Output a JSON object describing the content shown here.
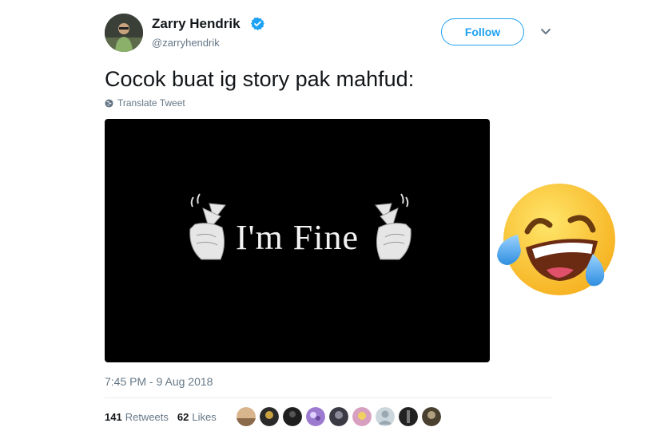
{
  "tweet": {
    "author": {
      "display_name": "Zarry Hendrik",
      "handle": "@zarryhendrik",
      "verified": true
    },
    "follow_label": "Follow",
    "text": "Cocok buat ig story pak mahfud:",
    "translate_label": "Translate Tweet",
    "media": {
      "caption": "I'm Fine"
    },
    "timestamp": "7:45 PM - 9 Aug 2018",
    "stats": {
      "retweets_count": "141",
      "retweets_label": "Retweets",
      "likes_count": "62",
      "likes_label": "Likes"
    },
    "liker_avatar_count": 9
  },
  "overlay": {
    "emoji": "face-with-tears-of-joy"
  },
  "colors": {
    "accent": "#1da1f2",
    "muted_text": "#657786",
    "primary_text": "#14171a",
    "divider": "#e6ecf0"
  }
}
